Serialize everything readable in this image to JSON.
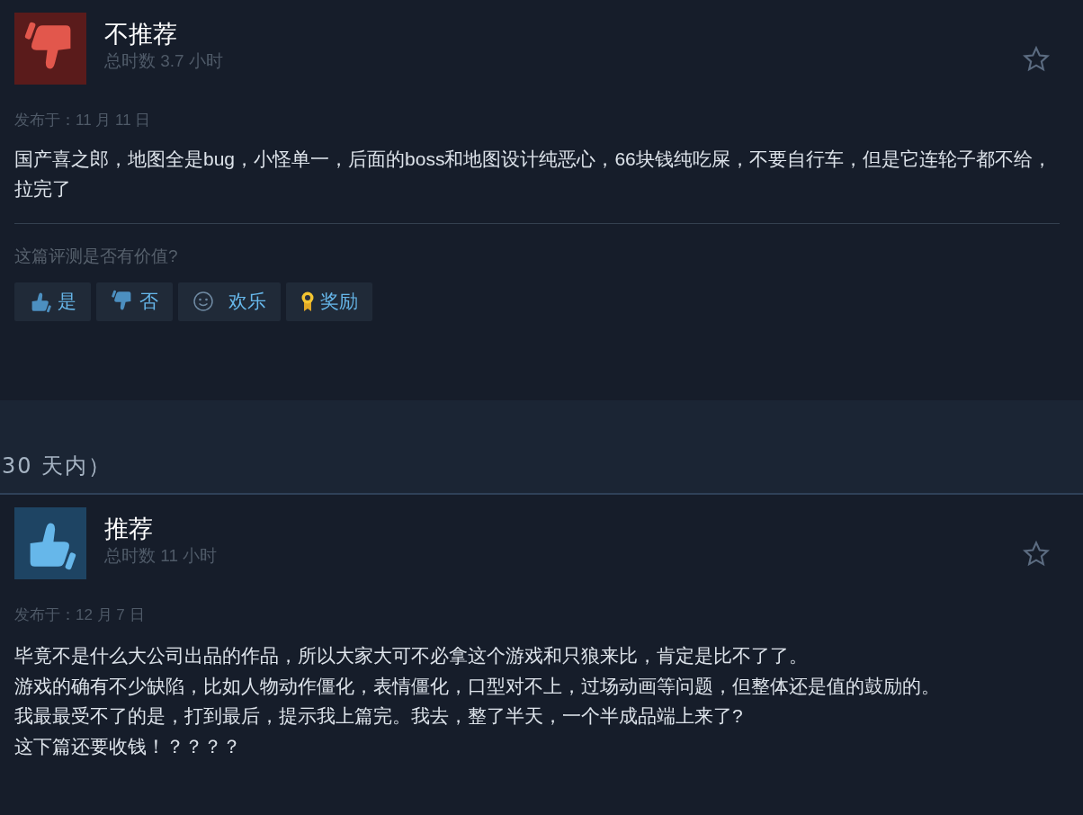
{
  "reviews": [
    {
      "recommended": false,
      "verdict": "不推荐",
      "playtime": "总时数 3.7 小时",
      "posted": "发布于：11 月 11 日",
      "body": [
        "国产喜之郎，地图全是bug，小怪单一，后面的boss和地图设计纯恶心，66块钱纯吃屎，不要自行车，但是它连轮子都不给，拉完了"
      ],
      "helpful_prompt": "这篇评测是否有价值?",
      "buttons": [
        {
          "kind": "yes",
          "label": "是"
        },
        {
          "kind": "no",
          "label": "否"
        },
        {
          "kind": "funny",
          "label": "欢乐"
        },
        {
          "kind": "award",
          "label": "奖励"
        }
      ]
    },
    {
      "recommended": true,
      "verdict": "推荐",
      "playtime": "总时数 11 小时",
      "posted": "发布于：12 月 7 日",
      "body": [
        "毕竟不是什么大公司出品的作品，所以大家大可不必拿这个游戏和只狼来比，肯定是比不了了。",
        "游戏的确有不少缺陷，比如人物动作僵化，表情僵化，口型对不上，过场动画等问题，但整体还是值的鼓励的。",
        "我最最受不了的是，打到最后，提示我上篇完。我去，整了半天，一个半成品端上来了?",
        "这下篇还要收钱！？？？？"
      ]
    }
  ],
  "section_label": "30 天内）"
}
